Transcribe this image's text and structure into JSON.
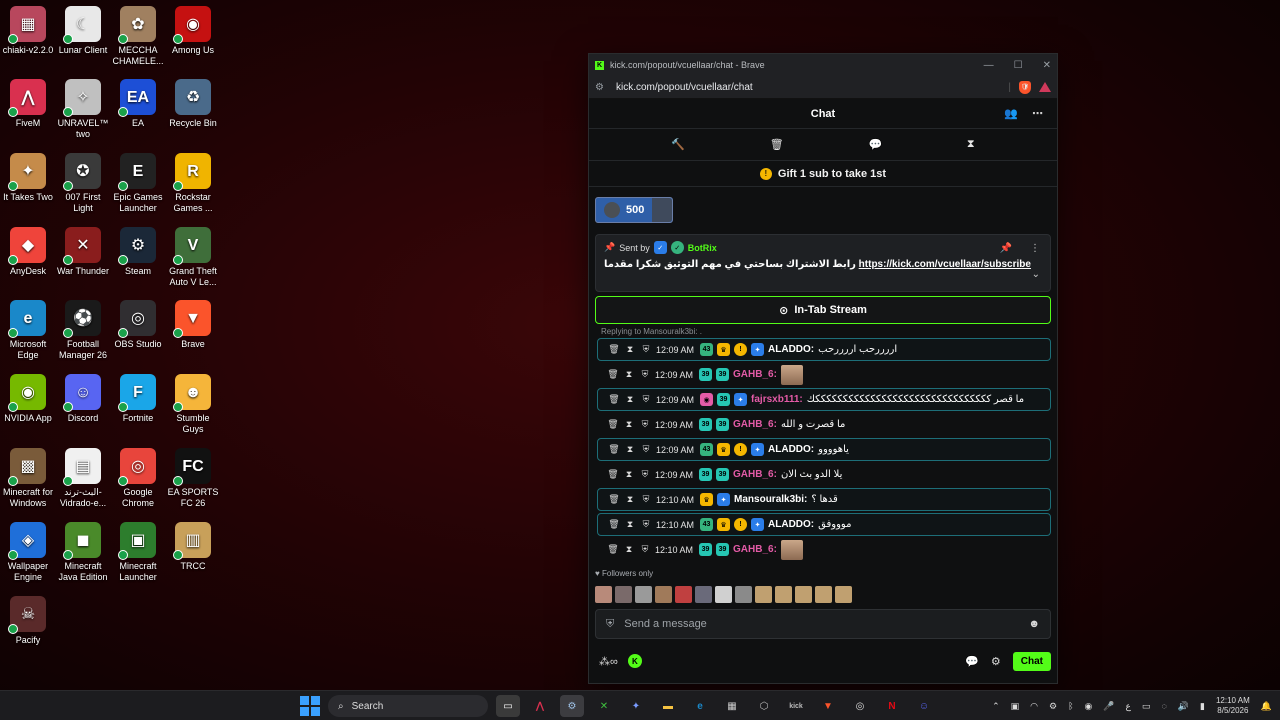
{
  "desktop": {
    "icons": [
      {
        "label": "chiaki-v2.2.0",
        "color": "#b8475d",
        "glyph": "▦"
      },
      {
        "label": "Lunar Client",
        "color": "#e8e8e8",
        "glyph": "☾"
      },
      {
        "label": "MECCHA CHAMELE...",
        "color": "#a08060",
        "glyph": "✿"
      },
      {
        "label": "Among Us",
        "color": "#c51111",
        "glyph": "◉"
      },
      {
        "label": "FiveM",
        "color": "#d9304f",
        "glyph": "⋀"
      },
      {
        "label": "UNRAVEL™ two",
        "color": "#c0c0c0",
        "glyph": "✧"
      },
      {
        "label": "EA",
        "color": "#1d4fd6",
        "glyph": "EA"
      },
      {
        "label": "Recycle Bin",
        "color": "#4a6a8a",
        "glyph": "♻"
      },
      {
        "label": "It Takes Two",
        "color": "#c58b4a",
        "glyph": "✦"
      },
      {
        "label": "007 First Light",
        "color": "#3a3a3a",
        "glyph": "✪"
      },
      {
        "label": "Epic Games Launcher",
        "color": "#222222",
        "glyph": "E"
      },
      {
        "label": "Rockstar Games ...",
        "color": "#f0b400",
        "glyph": "R"
      },
      {
        "label": "AnyDesk",
        "color": "#ef443b",
        "glyph": "◆"
      },
      {
        "label": "War Thunder",
        "color": "#8a1d1d",
        "glyph": "✕"
      },
      {
        "label": "Steam",
        "color": "#1b2838",
        "glyph": "⚙"
      },
      {
        "label": "Grand Theft Auto V Le...",
        "color": "#3f6e3a",
        "glyph": "V"
      },
      {
        "label": "Microsoft Edge",
        "color": "#1a88c9",
        "glyph": "e"
      },
      {
        "label": "Football Manager 26",
        "color": "#1a1a1a",
        "glyph": "⚽"
      },
      {
        "label": "OBS Studio",
        "color": "#302e31",
        "glyph": "◎"
      },
      {
        "label": "Brave",
        "color": "#fb542b",
        "glyph": "▼"
      },
      {
        "label": "NVIDIA App",
        "color": "#76b900",
        "glyph": "◉"
      },
      {
        "label": "Discord",
        "color": "#5865f2",
        "glyph": "☺"
      },
      {
        "label": "Fortnite",
        "color": "#1aa6e8",
        "glyph": "F"
      },
      {
        "label": "Stumble Guys",
        "color": "#f5b53a",
        "glyph": "☻"
      },
      {
        "label": "Minecraft for Windows",
        "color": "#7a5b3a",
        "glyph": "▩"
      },
      {
        "label": "البث-ترند-Vidrado-e...",
        "color": "#f0f0f0",
        "glyph": "▤"
      },
      {
        "label": "Google Chrome",
        "color": "#e8453c",
        "glyph": "◎"
      },
      {
        "label": "EA SPORTS FC 26",
        "color": "#111111",
        "glyph": "FC"
      },
      {
        "label": "Wallpaper Engine",
        "color": "#1f6fd9",
        "glyph": "◈"
      },
      {
        "label": "Minecraft Java Edition",
        "color": "#4a8a2a",
        "glyph": "◼"
      },
      {
        "label": "Minecraft Launcher",
        "color": "#2d7d2d",
        "glyph": "▣"
      },
      {
        "label": "TRCC",
        "color": "#c8a05a",
        "glyph": "▥"
      },
      {
        "label": "Pacify",
        "color": "#5a2a2a",
        "glyph": "☠"
      }
    ]
  },
  "browser": {
    "title": "kick.com/popout/vcuellaar/chat - Brave",
    "url": "kick.com/popout/vcuellaar/chat",
    "minimize": "—",
    "maximize": "☐",
    "close": "✕"
  },
  "chat": {
    "header_title": "Chat",
    "gift_text": "Gift 1 sub to take 1st",
    "goal_value": "500",
    "pinned": {
      "sent_by": "Sent by",
      "bot_name": "BotRix",
      "message": "رابط الاشتراك بساحتي في مهم التوثيق شكرا مقدما",
      "link": "https://kick.com/vcuellaar/subscribe"
    },
    "intab_label": "In-Tab Stream",
    "replying": "Replying to Mansouralk3bi: .",
    "messages": [
      {
        "time": "12:09 AM",
        "user": "ALADDO:",
        "user_color": "#ffffff",
        "text": "اررررحب اررررحب",
        "highlight": true,
        "badges": [
          "green",
          "crown",
          "coin",
          "vip"
        ],
        "emote": false
      },
      {
        "time": "12:09 AM",
        "user": "GAHB_6:",
        "user_color": "#e45ba7",
        "text": "",
        "highlight": false,
        "badges": [
          "teal",
          "teal"
        ],
        "emote": true
      },
      {
        "time": "12:09 AM",
        "user": "fajrsxb111:",
        "user_color": "#e45ba7",
        "text": "ما قصر ككككككككككككككككككككككككككككككككك",
        "highlight": true,
        "badges": [
          "pink",
          "teal",
          "vip"
        ],
        "emote": false
      },
      {
        "time": "12:09 AM",
        "user": "GAHB_6:",
        "user_color": "#e45ba7",
        "text": "ما قصرت و الله",
        "highlight": false,
        "badges": [
          "teal",
          "teal"
        ],
        "emote": false
      },
      {
        "time": "12:09 AM",
        "user": "ALADDO:",
        "user_color": "#ffffff",
        "text": "ياهوووو",
        "highlight": true,
        "badges": [
          "green",
          "crown",
          "coin",
          "vip"
        ],
        "emote": false
      },
      {
        "time": "12:09 AM",
        "user": "GAHB_6:",
        "user_color": "#e45ba7",
        "text": "يلا الدو بث الان",
        "highlight": false,
        "badges": [
          "teal",
          "teal"
        ],
        "emote": false
      },
      {
        "time": "12:10 AM",
        "user": "Mansouralk3bi:",
        "user_color": "#ffffff",
        "text": "قدها ؟",
        "highlight": true,
        "badges": [
          "crown",
          "vip"
        ],
        "emote": false
      },
      {
        "time": "12:10 AM",
        "user": "ALADDO:",
        "user_color": "#ffffff",
        "text": "موووفق",
        "highlight": true,
        "badges": [
          "green",
          "crown",
          "coin",
          "vip"
        ],
        "emote": false
      },
      {
        "time": "12:10 AM",
        "user": "GAHB_6:",
        "user_color": "#e45ba7",
        "text": "",
        "highlight": false,
        "badges": [
          "teal",
          "teal"
        ],
        "emote": true
      }
    ],
    "followers_label": "Followers only",
    "send_placeholder": "Send a message",
    "chat_button": "Chat"
  },
  "taskbar": {
    "search_label": "Search",
    "time": "12:10 AM",
    "date": "8/5/2026",
    "lang": "ع"
  }
}
